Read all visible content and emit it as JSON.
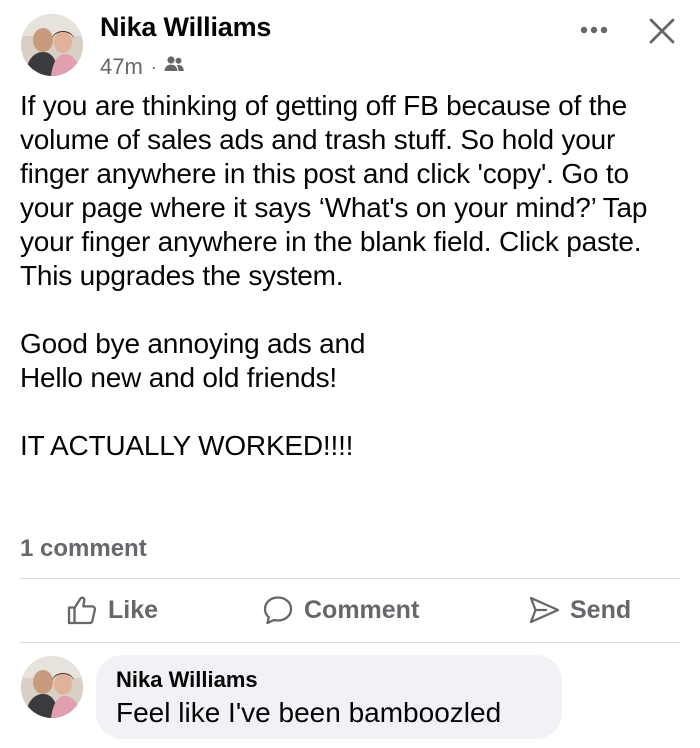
{
  "post": {
    "author": "Nika Williams",
    "time": "47m",
    "separator": "·",
    "audience_icon": "friends-icon",
    "body": "If you are thinking of getting off FB because of the volume of sales ads and trash stuff.  So hold your finger anywhere in this post and click 'copy'. Go to your page where it says ‘What's on your mind?’ Tap your finger anywhere in the blank field. Click paste. This upgrades the system.\n\nGood bye annoying ads and\nHello new and old friends!\n\nIT ACTUALLY WORKED!!!!",
    "comment_count": "1 comment"
  },
  "header_actions": {
    "more_icon": "more-dots-icon",
    "close_icon": "close-icon"
  },
  "actions": {
    "like_label": "Like",
    "comment_label": "Comment",
    "send_label": "Send",
    "like_icon": "thumbs-up-icon",
    "comment_icon": "speech-bubble-icon",
    "send_icon": "paper-plane-icon"
  },
  "comments": [
    {
      "author": "Nika Williams",
      "text": "Feel like I've been bamboozled"
    }
  ],
  "colors": {
    "text": "#050505",
    "secondary_text": "#65676b",
    "comment_bubble": "#f0f2f5",
    "divider": "#d7d9dc"
  }
}
